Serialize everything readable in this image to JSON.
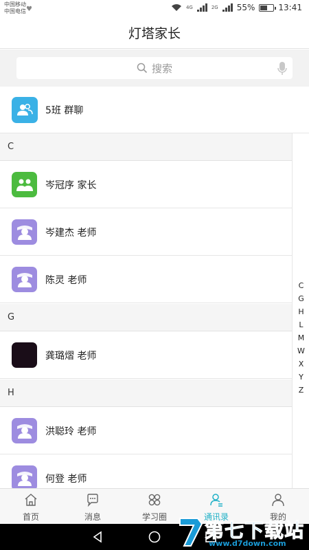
{
  "status_bar": {
    "carrier1": "中国移动",
    "carrier2": "中国电信",
    "network1": "4G",
    "network2": "2G",
    "battery": "55%",
    "battery_level": 0.55,
    "time": "13:41"
  },
  "header": {
    "title": "灯塔家长"
  },
  "search": {
    "placeholder": "搜索"
  },
  "group": {
    "name": "5班 群聊",
    "color": "#3ab1e6"
  },
  "sections": [
    {
      "letter": "C",
      "contacts": [
        {
          "name": "岑冠序 家长",
          "avatar": "parent-avatar",
          "color": "#4cbb3f"
        },
        {
          "name": "岑建杰 老师",
          "avatar": "teacher-avatar",
          "color": "#9d8ce0"
        },
        {
          "name": "陈灵 老师",
          "avatar": "teacher-avatar",
          "color": "#9d8ce0"
        }
      ]
    },
    {
      "letter": "G",
      "contacts": [
        {
          "name": "龚璐熠 老师",
          "avatar": "photo-avatar",
          "color": "#1a0d18"
        }
      ]
    },
    {
      "letter": "H",
      "contacts": [
        {
          "name": "洪聪玲 老师",
          "avatar": "teacher-avatar",
          "color": "#9d8ce0"
        },
        {
          "name": "何登 老师",
          "avatar": "teacher-avatar",
          "color": "#9d8ce0"
        }
      ]
    }
  ],
  "index_letters": [
    "C",
    "G",
    "H",
    "L",
    "M",
    "W",
    "X",
    "Y",
    "Z"
  ],
  "tabs": [
    {
      "label": "首页",
      "icon": "home-icon",
      "active": false
    },
    {
      "label": "消息",
      "icon": "message-icon",
      "active": false
    },
    {
      "label": "学习圈",
      "icon": "clover-icon",
      "active": false
    },
    {
      "label": "通讯录",
      "icon": "contacts-icon",
      "active": true
    },
    {
      "label": "我的",
      "icon": "person-icon",
      "active": false
    }
  ],
  "watermark": {
    "title": "第七下载站",
    "url": "www.d7down.com"
  },
  "colors": {
    "accent": "#20b1c7",
    "group": "#3ab1e6",
    "parent": "#4cbb3f",
    "teacher": "#9d8ce0"
  }
}
